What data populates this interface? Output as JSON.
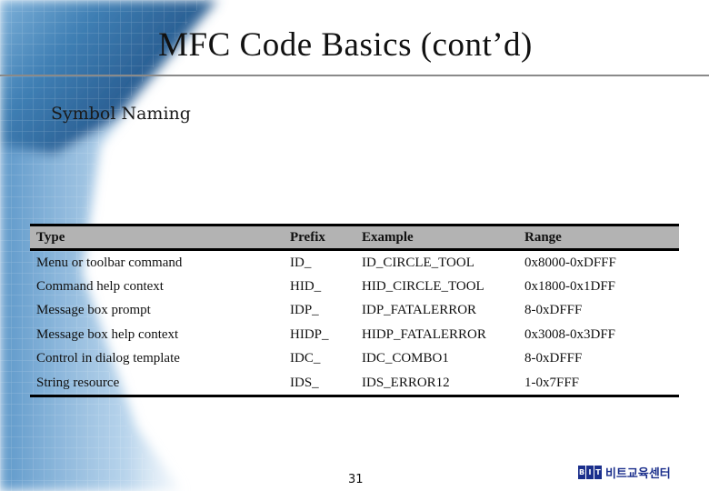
{
  "slide": {
    "title": "MFC Code Basics (cont’d)",
    "subtitle": "Symbol Naming",
    "page_number": "31"
  },
  "table": {
    "headers": [
      "Type",
      "Prefix",
      "Example",
      "Range"
    ],
    "rows": [
      [
        "Menu or toolbar command",
        "ID_",
        "ID_CIRCLE_TOOL",
        "0x8000-0xDFFF"
      ],
      [
        "Command help context",
        "HID_",
        "HID_CIRCLE_TOOL",
        "0x1800-0x1DFF"
      ],
      [
        "Message box prompt",
        "IDP_",
        "IDP_FATALERROR",
        "8-0xDFFF"
      ],
      [
        "Message box help context",
        "HIDP_",
        "HIDP_FATALERROR",
        "0x3008-0x3DFF"
      ],
      [
        "Control in dialog template",
        "IDC_",
        "IDC_COMBO1",
        "8-0xDFFF"
      ],
      [
        "String resource",
        "IDS_",
        "IDS_ERROR12",
        "1-0x7FFF"
      ]
    ]
  },
  "logo": {
    "letters": [
      "B",
      "I",
      "T"
    ],
    "text": "비트교육센터",
    "color": "#1b2f8c"
  },
  "colors": {
    "header_fill": "#b3b3b3",
    "rule": "#8a8a8a",
    "background_accent": "#2f6ea5"
  }
}
